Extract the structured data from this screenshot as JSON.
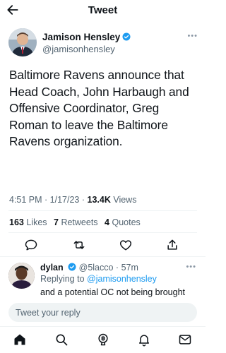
{
  "header": {
    "title": "Tweet",
    "back_icon": "arrow-left-icon"
  },
  "author": {
    "name": "Jamison Hensley",
    "handle": "@jamisonhensley",
    "verified": true,
    "verified_color": "#1d9bf0"
  },
  "tweet": {
    "text": "Baltimore Ravens announce that Head Coach, John Harbaugh and Offensive Coordinator, Greg Roman to leave the Baltimore Ravens organization.",
    "time": "4:51 PM",
    "date": "1/17/23",
    "views_count": "13.4K",
    "views_label": "Views"
  },
  "stats": {
    "likes_count": "163",
    "likes_label": "Likes",
    "retweets_count": "7",
    "retweets_label": "Retweets",
    "quotes_count": "4",
    "quotes_label": "Quotes"
  },
  "actions": [
    "reply-icon",
    "retweet-icon",
    "like-icon",
    "share-icon"
  ],
  "reply": {
    "name": "dylan",
    "handle": "@5lacco",
    "time": "57m",
    "replying_prefix": "Replying to",
    "replying_handle": "@jamisonhensley",
    "text": "and a potential OC not being brought"
  },
  "composer": {
    "placeholder": "Tweet your reply"
  },
  "tabbar": [
    "home-icon",
    "search-icon",
    "spaces-icon",
    "notifications-icon",
    "messages-icon"
  ],
  "colors": {
    "accent": "#1d9bf0",
    "text": "#0f1419",
    "muted": "#536471",
    "divider": "#eff3f4"
  }
}
